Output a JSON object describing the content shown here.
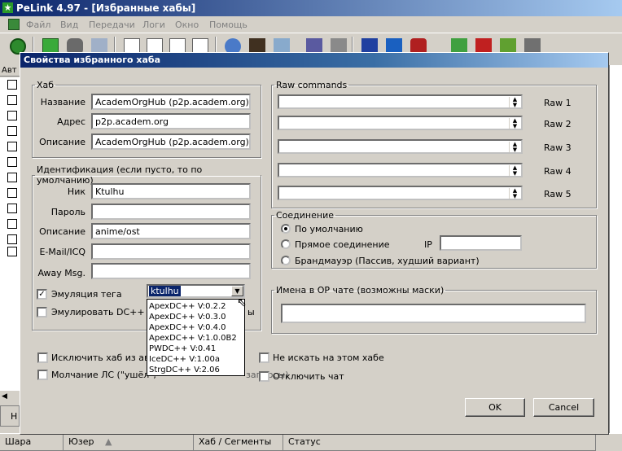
{
  "window": {
    "title": "PeLink  4.97 - [Избранные хабы]"
  },
  "menu": [
    "Файл",
    "Вид",
    "Передачи",
    "Логи",
    "Окно",
    "Помощь"
  ],
  "background": {
    "left_header": "Авт",
    "columns": [
      "Шара",
      "Юзер",
      "Хаб / Сегменты",
      "Статус"
    ],
    "tab_label": "Н"
  },
  "dialog": {
    "title": "Свойства избранного хаба",
    "hub": {
      "legend": "Хаб",
      "name_label": "Название",
      "name_value": "AcademOrgHub (p2p.academ.org)",
      "address_label": "Адрес",
      "address_value": "p2p.academ.org",
      "desc_label": "Описание",
      "desc_value": "AcademOrgHub (p2p.academ.org)"
    },
    "identity": {
      "legend": "Идентификация (если пусто, то по умолчанию)",
      "nick_label": "Ник",
      "nick_value": "Ktulhu",
      "password_label": "Пароль",
      "password_value": "",
      "desc_label": "Описание",
      "desc_value": "anime/ost",
      "email_label": "E-Mail/ICQ",
      "email_value": "",
      "away_label": "Away Msg.",
      "away_value": "",
      "tag_emulation_label": "Эмуляция тега",
      "tag_emulation_checked": true,
      "tag_selected": "ktulhu",
      "tag_options": [
        "ApexDC++ V:0.2.2",
        "ApexDC++ V:0.3.0",
        "ApexDC++ V:0.4.0",
        "ApexDC++ V:1.0.0B2",
        "PWDC++ V:0.41",
        "IceDC++ V:1.00a",
        "StrgDC++ V:2.06"
      ],
      "emulate_dc_label": "Эмулировать DC++ на",
      "emulate_dc_tail": "ы",
      "emulate_dc_checked": false
    },
    "raw": {
      "legend": "Raw commands",
      "items": [
        {
          "label": "Raw 1",
          "value": ""
        },
        {
          "label": "Raw 2",
          "value": ""
        },
        {
          "label": "Raw 3",
          "value": ""
        },
        {
          "label": "Raw 4",
          "value": ""
        },
        {
          "label": "Raw 5",
          "value": ""
        }
      ]
    },
    "connection": {
      "legend": "Соединение",
      "default_label": "По умолчанию",
      "direct_label": "Прямое соединение",
      "firewall_label": "Брандмауэр (Пассив, худший вариант)",
      "ip_label": "IP",
      "ip_value": "",
      "selected": "default"
    },
    "op_names": {
      "legend": "Имена в OP чате (возможны маски)",
      "value": ""
    },
    "options": {
      "exclude_label": "Исключить хаб из авто",
      "silence_label": "Молчание ЛС (\"ушёл\", ",
      "silence_tail": "запросы)",
      "no_search_label": "Не искать на этом хабе",
      "disable_chat_label": "Отключить чат"
    },
    "ok_label": "OK",
    "cancel_label": "Cancel"
  },
  "colors": {
    "titlebar": "#0a246a",
    "selection": "#0a246a",
    "face": "#d4d0c8"
  }
}
